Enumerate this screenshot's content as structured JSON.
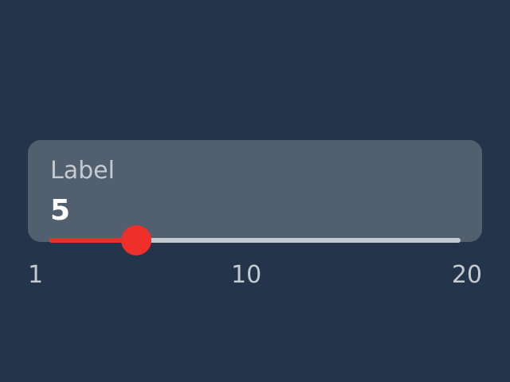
{
  "slider": {
    "label": "Label",
    "value": 5,
    "min": 1,
    "max": 20,
    "ticks": {
      "min_label": "1",
      "mid_label": "10",
      "max_label": "20"
    }
  },
  "colors": {
    "background": "#24354b",
    "card": "#525f6e",
    "accent": "#ee2f2a",
    "track": "#c4c8cf",
    "label_text": "#c4cad2",
    "value_text": "#ffffff"
  }
}
